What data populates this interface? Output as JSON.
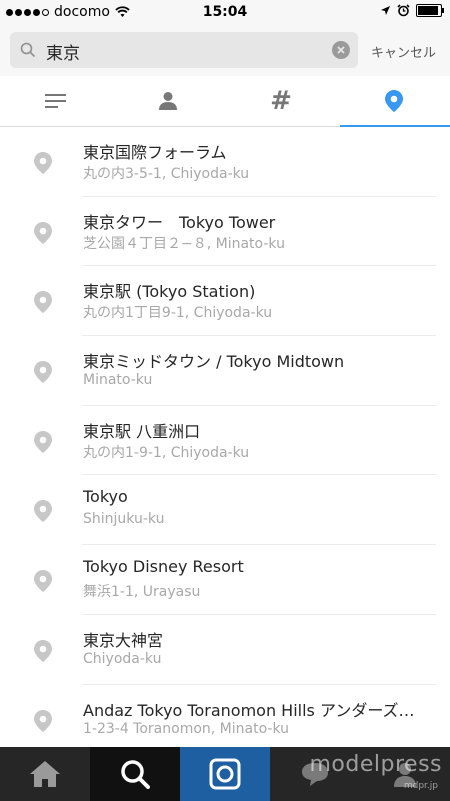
{
  "status_bar": {
    "carrier": "docomo",
    "time": "15:04",
    "battery_level": 0.9
  },
  "search": {
    "query": "東京",
    "cancel_label": "キャンセル"
  },
  "tabs": [
    {
      "icon": "list-icon",
      "active": false
    },
    {
      "icon": "person-icon",
      "active": false
    },
    {
      "icon": "hashtag-icon",
      "label": "#",
      "active": false
    },
    {
      "icon": "location-pin-icon",
      "active": true
    }
  ],
  "results": [
    {
      "title": "東京国際フォーラム",
      "subtitle": "丸の内3-5-1, Chiyoda-ku"
    },
    {
      "title": "東京タワー　Tokyo Tower",
      "subtitle": "芝公園４丁目２−８, Minato-ku"
    },
    {
      "title": "東京駅 (Tokyo Station)",
      "subtitle": "丸の内1丁目9-1, Chiyoda-ku"
    },
    {
      "title": "東京ミッドタウン / Tokyo Midtown",
      "subtitle": "Minato-ku"
    },
    {
      "title": "東京駅 八重洲口",
      "subtitle": "丸の内1-9-1, Chiyoda-ku"
    },
    {
      "title": "Tokyo",
      "subtitle": "Shinjuku-ku"
    },
    {
      "title": "Tokyo Disney Resort",
      "subtitle": "舞浜1-1, Urayasu"
    },
    {
      "title": "東京大神宮",
      "subtitle": "Chiyoda-ku"
    },
    {
      "title": "Andaz Tokyo Toranomon Hills アンダーズ…",
      "subtitle": "1-23-4 Toranomon, Minato-ku"
    }
  ],
  "bottom_nav": [
    {
      "icon": "home-icon"
    },
    {
      "icon": "search-icon"
    },
    {
      "icon": "camera-icon"
    },
    {
      "icon": "activity-icon"
    },
    {
      "icon": "profile-icon"
    }
  ],
  "watermark": {
    "brand": "modelpress",
    "url": "mdpr.jp"
  },
  "colors": {
    "accent": "#3897f0",
    "nav_bg": "#262626",
    "camera_tab": "#1d5fa0",
    "subtitle": "#a8a8a8"
  }
}
